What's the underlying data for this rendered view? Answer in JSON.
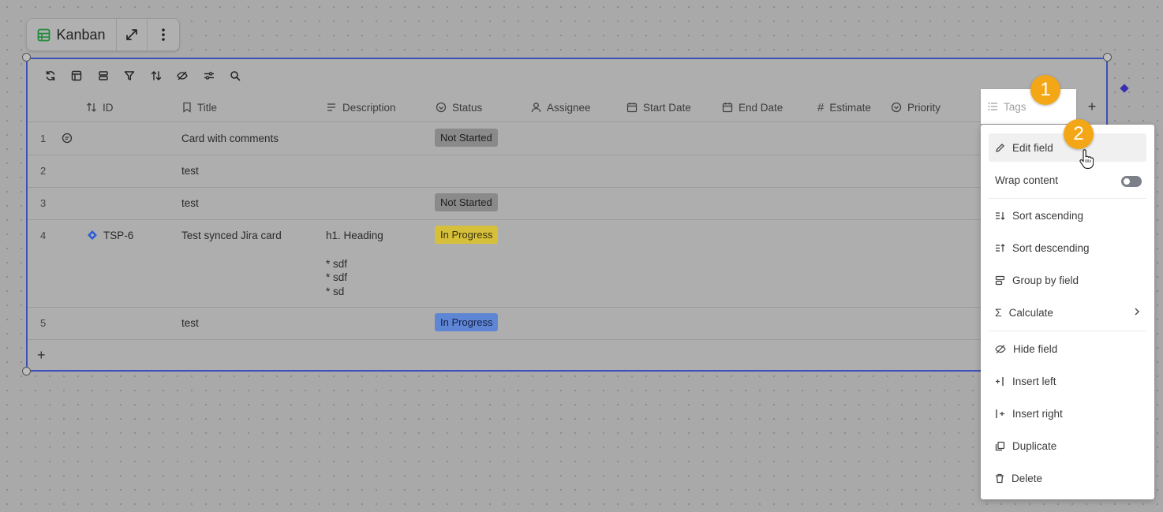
{
  "view": {
    "title": "Kanban"
  },
  "toolbar_icons": [
    "refresh-icon",
    "layout-icon",
    "group-icon",
    "filter-icon",
    "sort-icon",
    "hide-icon",
    "settings-icon",
    "search-icon"
  ],
  "columns": {
    "id": "ID",
    "title": "Title",
    "description": "Description",
    "status": "Status",
    "assignee": "Assignee",
    "start_date": "Start Date",
    "end_date": "End Date",
    "estimate": "Estimate",
    "priority": "Priority",
    "tags": "Tags"
  },
  "rows": [
    {
      "num": "1",
      "title": "Card with comments",
      "status": "Not Started",
      "status_color": "#8a8a8a"
    },
    {
      "num": "2",
      "title": "test"
    },
    {
      "num": "3",
      "title": "test",
      "status": "Not Started",
      "status_color": "#8a8a8a"
    },
    {
      "num": "4",
      "id": "TSP-6",
      "title": "Test synced Jira card",
      "desc_heading": "h1. Heading",
      "desc_items": [
        "* sdf",
        "* sdf",
        "* sd"
      ],
      "status": "In Progress",
      "status_color": "#d6c03a"
    },
    {
      "num": "5",
      "title": "test",
      "status": "In Progress",
      "status_color": "#5f86d4"
    }
  ],
  "add_row_symbol": "+",
  "add_column_symbol": "+",
  "menu": {
    "edit_field": "Edit field",
    "wrap_content": "Wrap content",
    "sort_ascending": "Sort ascending",
    "sort_descending": "Sort descending",
    "group_by_field": "Group by field",
    "calculate": "Calculate",
    "hide_field": "Hide field",
    "insert_left": "Insert left",
    "insert_right": "Insert right",
    "duplicate": "Duplicate",
    "delete": "Delete"
  },
  "wrap_content_enabled": false,
  "steps": [
    "1",
    "2"
  ],
  "colors": {
    "accent_border": "#3b52b8",
    "step_badge": "#f4a716",
    "not_started": "#8a8a8a",
    "in_progress_yellow": "#d6c03a",
    "in_progress_blue": "#5f86d4",
    "jira": "#2a5bd7"
  }
}
